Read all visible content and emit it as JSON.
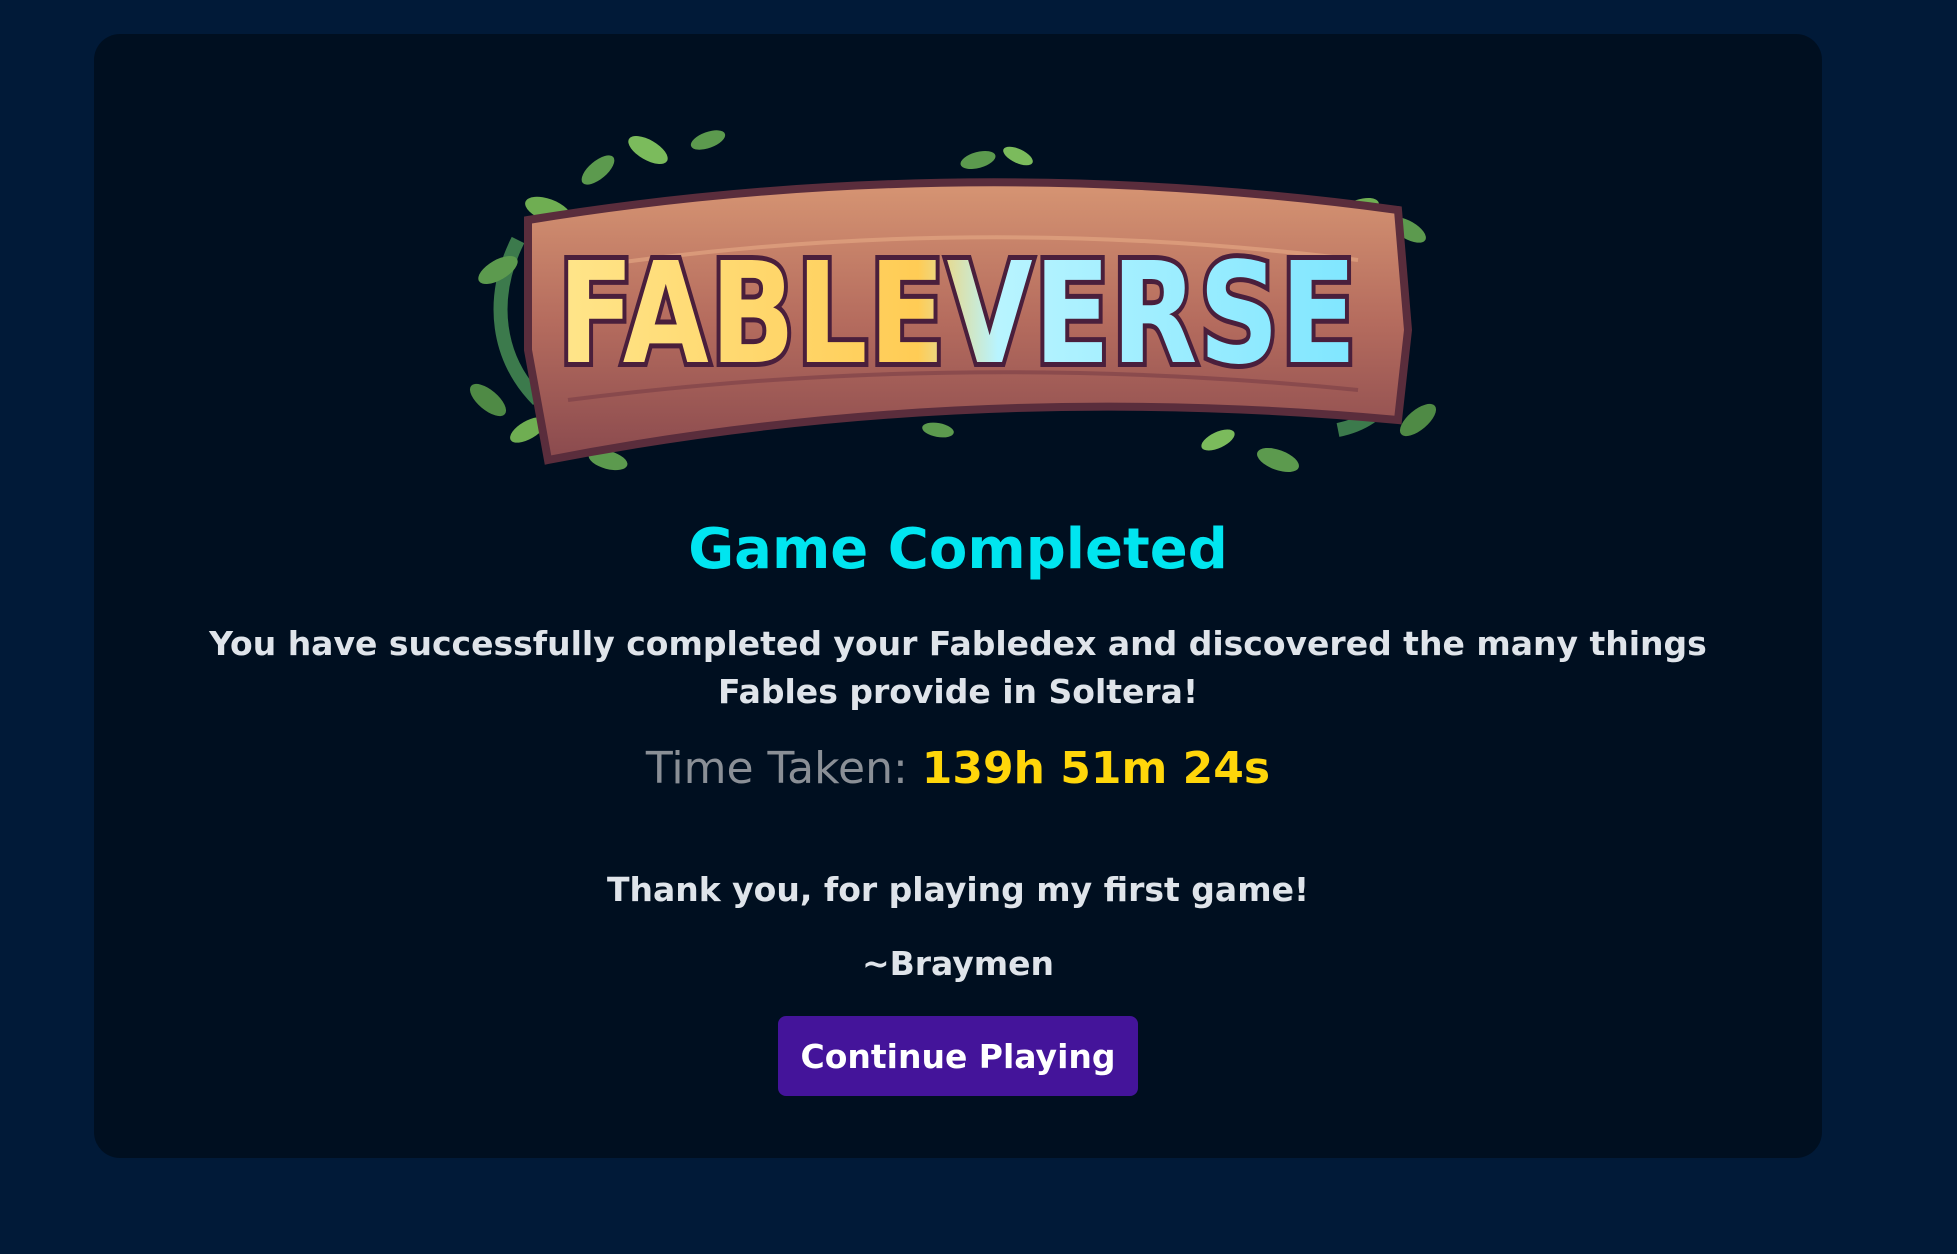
{
  "logo": {
    "text": "FABLEVERSE",
    "icon": "fableverse-logo"
  },
  "dialog": {
    "title": "Game Completed",
    "message": "You have successfully completed your Fabledex and discovered the many things Fables provide in Soltera!",
    "time_label": "Time Taken:",
    "time_value": "139h 51m 24s",
    "thanks": "Thank you, for playing my first game!",
    "signature": "~Braymen",
    "continue_label": "Continue Playing"
  },
  "colors": {
    "page_background": "#011a38",
    "panel_background": "#000f20",
    "title": "#00e5f0",
    "time_value": "#ffd60a",
    "button": "#44149a"
  }
}
